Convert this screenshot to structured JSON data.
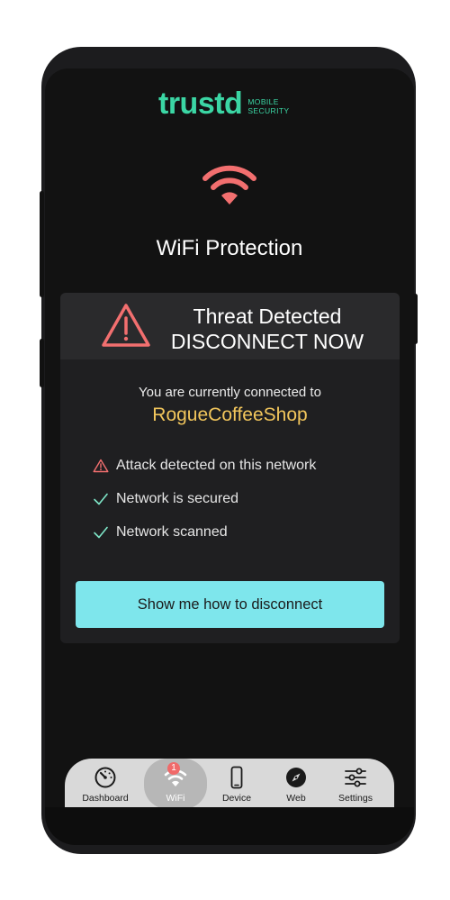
{
  "app": {
    "brand": "trustd",
    "brand_sub_line1": "MOBILE",
    "brand_sub_line2": "SECURITY",
    "accent_color": "#3bd6a4"
  },
  "hero": {
    "icon": "wifi-icon",
    "title": "WiFi Protection",
    "icon_color": "#f26f6f"
  },
  "alert": {
    "icon": "warning-triangle-icon",
    "heading_line1": "Threat Detected",
    "heading_line2": "DISCONNECT NOW",
    "connected_text": "You are currently connected to",
    "network_name": "RogueCoffeeShop",
    "network_color": "#f2c65c"
  },
  "status_items": [
    {
      "icon": "warning-icon",
      "text": "Attack detected on this network",
      "color": "#f26f6f"
    },
    {
      "icon": "check-icon",
      "text": "Network is secured",
      "color": "#7ee6c8"
    },
    {
      "icon": "check-icon",
      "text": "Network scanned",
      "color": "#7ee6c8"
    }
  ],
  "cta": {
    "label": "Show me how to disconnect",
    "color": "#7ee6ec"
  },
  "tabs": [
    {
      "icon": "speedometer-icon",
      "label": "Dashboard",
      "active": false
    },
    {
      "icon": "wifi-icon",
      "label": "WiFi",
      "active": true,
      "badge": "1"
    },
    {
      "icon": "phone-icon",
      "label": "Device",
      "active": false
    },
    {
      "icon": "compass-icon",
      "label": "Web",
      "active": false
    },
    {
      "icon": "sliders-icon",
      "label": "Settings",
      "active": false
    }
  ]
}
